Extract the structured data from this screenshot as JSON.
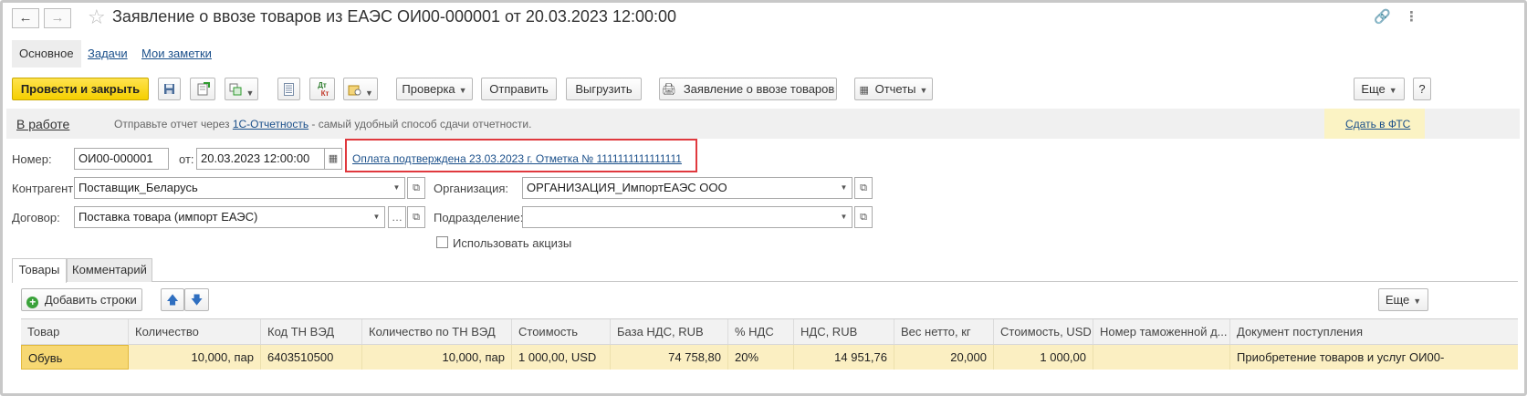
{
  "window": {
    "title": "Заявление о ввозе товаров из ЕАЭС ОИ00-000001 от 20.03.2023 12:00:00",
    "back_icon": "arrow-left-icon",
    "forward_icon": "arrow-right-icon",
    "favorite_icon": "star-icon",
    "link_icon": "link-icon",
    "more_icon": "vertical-dots-icon"
  },
  "section_tabs": [
    {
      "label": "Основное",
      "active": true
    },
    {
      "label": "Задачи",
      "active": false
    },
    {
      "label": "Мои заметки",
      "active": false
    }
  ],
  "toolbar": {
    "post_and_close": "Провести и закрыть",
    "check": "Проверка",
    "send": "Отправить",
    "upload": "Выгрузить",
    "print_statement": "Заявление о ввозе товаров",
    "reports": "Отчеты",
    "more": "Еще",
    "help": "?",
    "dt_kt_top": "Дт",
    "dt_kt_bottom": "Кт"
  },
  "status_band": {
    "status": "В работе",
    "hint_prefix": "Отправьте отчет через ",
    "hint_link": "1С-Отчетность",
    "hint_suffix": " - самый удобный способ сдачи отчетности.",
    "submit_link": "Сдать в ФТС"
  },
  "form": {
    "number_label": "Номер:",
    "number_value": "ОИ00-000001",
    "date_label": "от:",
    "date_value": "20.03.2023 12:00:00",
    "payment_link": "Оплата подтверждена 23.03.2023 г. Отметка № 1111111111111111",
    "counterparty_label": "Контрагент:",
    "counterparty_value": "Поставщик_Беларусь",
    "organization_label": "Организация:",
    "organization_value": "ОРГАНИЗАЦИЯ_ИмпортЕАЭС ООО",
    "contract_label": "Договор:",
    "contract_value": "Поставка товара (импорт ЕАЭС)",
    "department_label": "Подразделение:",
    "department_value": "",
    "excise_label": "Использовать акцизы",
    "excise_checked": false
  },
  "tabs": [
    {
      "label": "Товары",
      "active": true
    },
    {
      "label": "Комментарий",
      "active": false
    }
  ],
  "table_toolbar": {
    "add_rows": "Добавить строки",
    "more": "Еще"
  },
  "table": {
    "columns": [
      "Товар",
      "Количество",
      "Код ТН ВЭД",
      "Количество по ТН ВЭД",
      "Стоимость",
      "База НДС, RUB",
      "% НДС",
      "НДС, RUB",
      "Вес нетто, кг",
      "Стоимость, USD",
      "Номер таможенной д...",
      "Документ поступления"
    ],
    "rows": [
      [
        "Обувь",
        "10,000, пар",
        "6403510500",
        "10,000, пар",
        "1 000,00, USD",
        "74 758,80",
        "20%",
        "14 951,76",
        "20,000",
        "1 000,00",
        "",
        "Приобретение товаров и услуг ОИ00-"
      ]
    ]
  },
  "colors": {
    "accent_yellow": "#f5cf00",
    "link": "#1a4f8a",
    "highlight_box": "#e0393e",
    "row_selected": "#fbefc2"
  }
}
